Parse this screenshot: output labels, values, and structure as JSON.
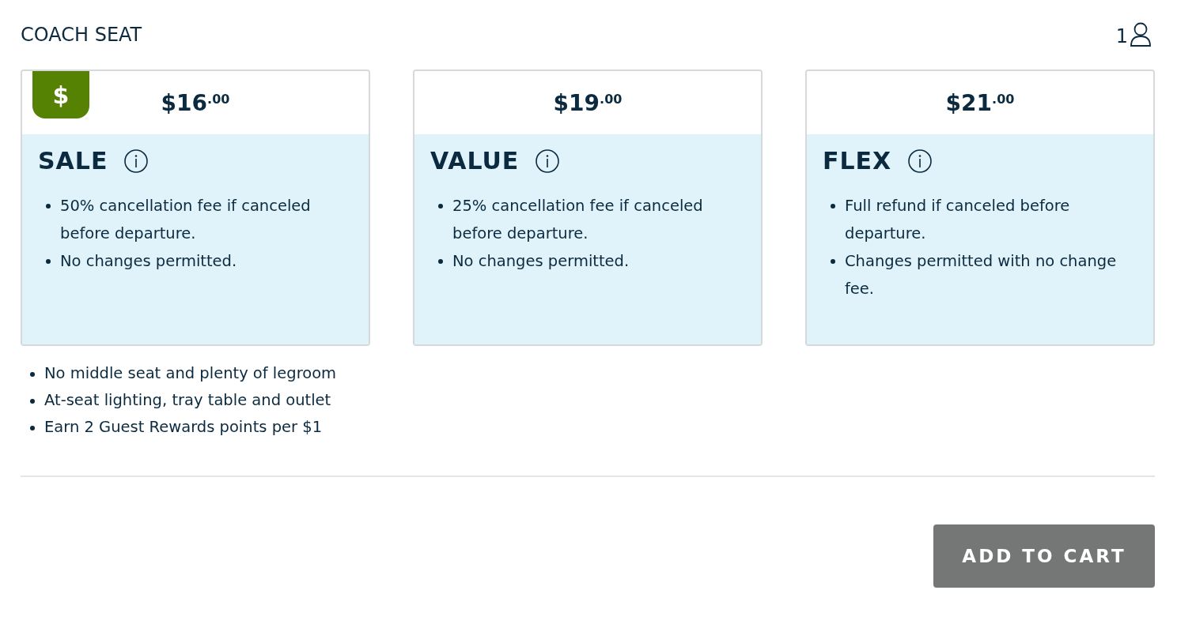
{
  "header": {
    "title": "COACH SEAT",
    "passenger_count": "1"
  },
  "fares": [
    {
      "badge": "$",
      "dollars": "$16",
      "cents": ".00",
      "name": "SALE",
      "terms": [
        "50% cancellation fee if canceled before departure.",
        "No changes permitted."
      ]
    },
    {
      "dollars": "$19",
      "cents": ".00",
      "name": "VALUE",
      "terms": [
        "25% cancellation fee if canceled before departure.",
        "No changes permitted."
      ]
    },
    {
      "dollars": "$21",
      "cents": ".00",
      "name": "FLEX",
      "terms": [
        "Full refund if canceled before departure.",
        "Changes permitted with no change fee."
      ]
    }
  ],
  "features": [
    "No middle seat and plenty of legroom",
    "At-seat lighting, tray table and outlet",
    "Earn 2 Guest Rewards points per $1"
  ],
  "add_to_cart": {
    "label": "ADD TO CART",
    "disabled": true
  }
}
